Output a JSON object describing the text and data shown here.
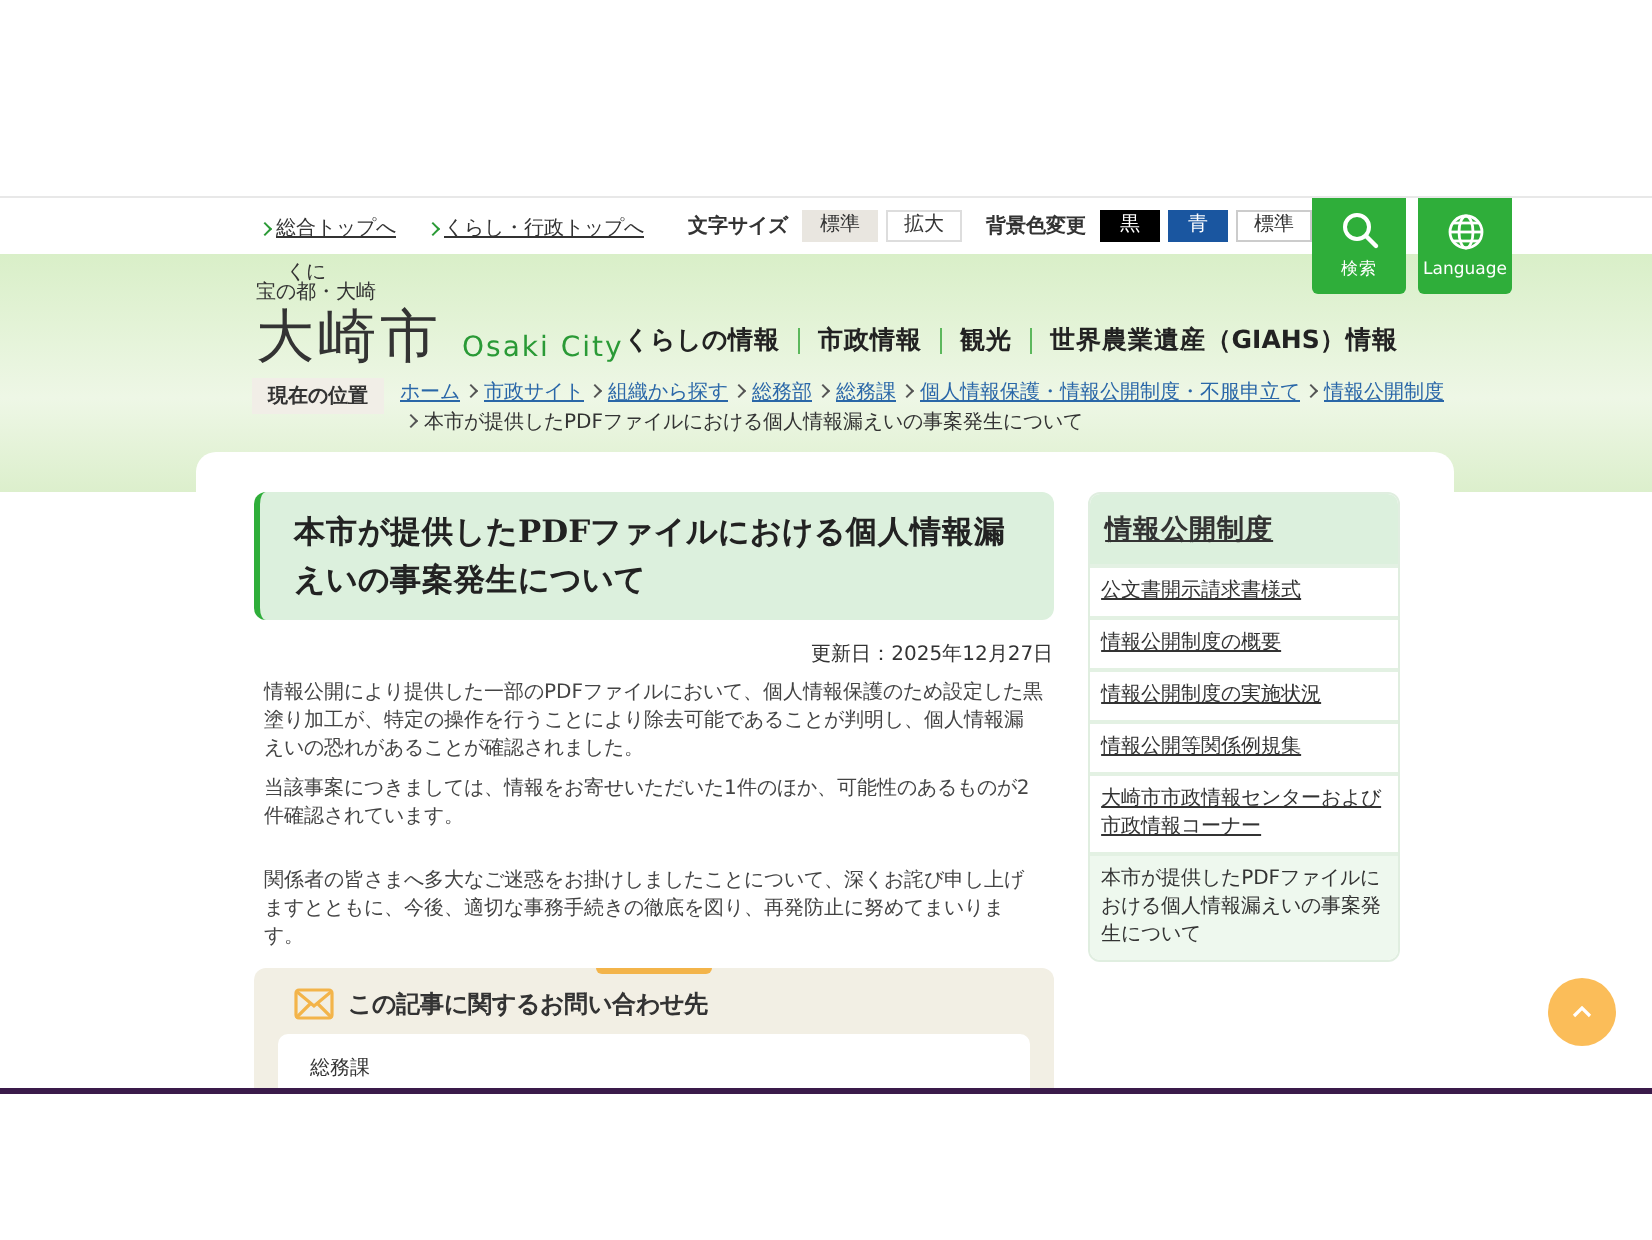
{
  "top_links": [
    {
      "label": "総合トップへ"
    },
    {
      "label": "くらし・行政トップへ"
    }
  ],
  "text_size": {
    "label": "文字サイズ",
    "options": [
      {
        "label": "標準",
        "selected": true
      },
      {
        "label": "拡大",
        "selected": false
      }
    ]
  },
  "bg_color": {
    "label": "背景色変更",
    "options": [
      {
        "label": "黒",
        "kind": "black"
      },
      {
        "label": "青",
        "kind": "blue"
      },
      {
        "label": "標準",
        "kind": "standard"
      }
    ]
  },
  "header_buttons": [
    {
      "label": "検索",
      "kind": "search"
    },
    {
      "label": "Language",
      "kind": "language"
    }
  ],
  "logo": {
    "tagline_before": "宝の",
    "ruby_base": "都",
    "ruby": "くに",
    "tagline_after": "・大崎",
    "name": "大崎市",
    "roman": "Osaki City"
  },
  "nav": [
    "くらしの情報",
    "市政情報",
    "観光",
    "世界農業遺産（GIAHS）情報"
  ],
  "breadcrumb": {
    "label": "現在の位置",
    "links": [
      "ホーム",
      "市政サイト",
      "組織から探す",
      "総務部",
      "総務課",
      "個人情報保護・情報公開制度・不服申立て",
      "情報公開制度"
    ],
    "current": "本市が提供したPDFファイルにおける個人情報漏えいの事案発生について"
  },
  "article": {
    "title": "本市が提供したPDFファイルにおける個人情報漏えいの事案発生について",
    "updated": "更新日：2025年12月27日",
    "paragraphs": [
      "情報公開により提供した一部のPDFファイルにおいて、個人情報保護のため設定した黒塗り加工が、特定の操作を行うことにより除去可能であることが判明し、個人情報漏えいの恐れがあることが確認されました。",
      "当該事案につきましては、情報をお寄せいただいた1件のほか、可能性のあるものが2件確認されています。",
      "関係者の皆さまへ多大なご迷惑をお掛けしましたことについて、深くお詫び申し上げますとともに、今後、適切な事務手続きの徹底を図り、再発防止に努めてまいります。"
    ]
  },
  "contact": {
    "heading": "この記事に関するお問い合わせ先",
    "department": "総務課"
  },
  "sidebar": {
    "title": "情報公開制度",
    "items": [
      {
        "label": "公文書開示請求書様式",
        "selected": false
      },
      {
        "label": "情報公開制度の概要",
        "selected": false
      },
      {
        "label": "情報公開制度の実施状況",
        "selected": false
      },
      {
        "label": "情報公開等関係例規集",
        "selected": false
      },
      {
        "label": "大崎市市政情報センターおよび市政情報コーナー",
        "selected": false
      },
      {
        "label": "本市が提供したPDFファイルにおける個人情報漏えいの事案発生について",
        "selected": true
      }
    ]
  }
}
